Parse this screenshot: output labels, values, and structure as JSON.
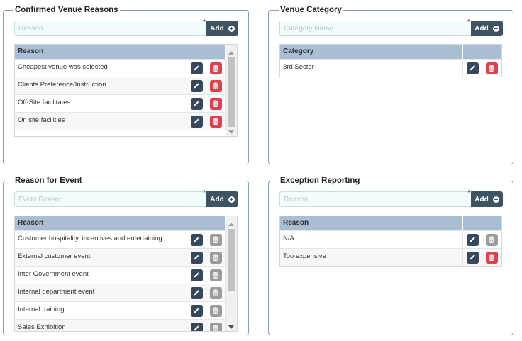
{
  "panels": {
    "venue_reasons": {
      "title": "Confirmed Venue Reasons",
      "placeholder": "Reason",
      "add_label": "Add",
      "column": "Reason",
      "rows": [
        "Cheapest venue was selected",
        "Clients Preference/Instruction",
        "Off-Site facilitates",
        "On site facilities"
      ]
    },
    "venue_category": {
      "title": "Venue Category",
      "placeholder": "Category Name",
      "add_label": "Add",
      "column": "Category",
      "rows": [
        "3rd Sector"
      ]
    },
    "event_reason": {
      "title": "Reason for Event",
      "placeholder": "Event Reason",
      "add_label": "Add",
      "column": "Reason",
      "rows": [
        "Customer hospitality, incentives and entertaining",
        "External customer event",
        "Inter Government event",
        "Internal department event",
        "Internal training",
        "Sales Exhibition"
      ]
    },
    "exception_reporting": {
      "title": "Exception Reporting",
      "placeholder": "Reason",
      "add_label": "Add",
      "column": "Reason",
      "rows": [
        "N/A",
        "Too expensive"
      ]
    }
  },
  "required_marker": "*",
  "icons": {
    "edit": "pencil-icon",
    "delete": "trash-icon",
    "add": "plus-circle-icon"
  },
  "colors": {
    "header": "#a9bdd3",
    "button_dark": "#3e5364",
    "delete_active": "#e0404d",
    "delete_disabled": "#9c9c9c",
    "input_bg": "#f2fcfd"
  }
}
